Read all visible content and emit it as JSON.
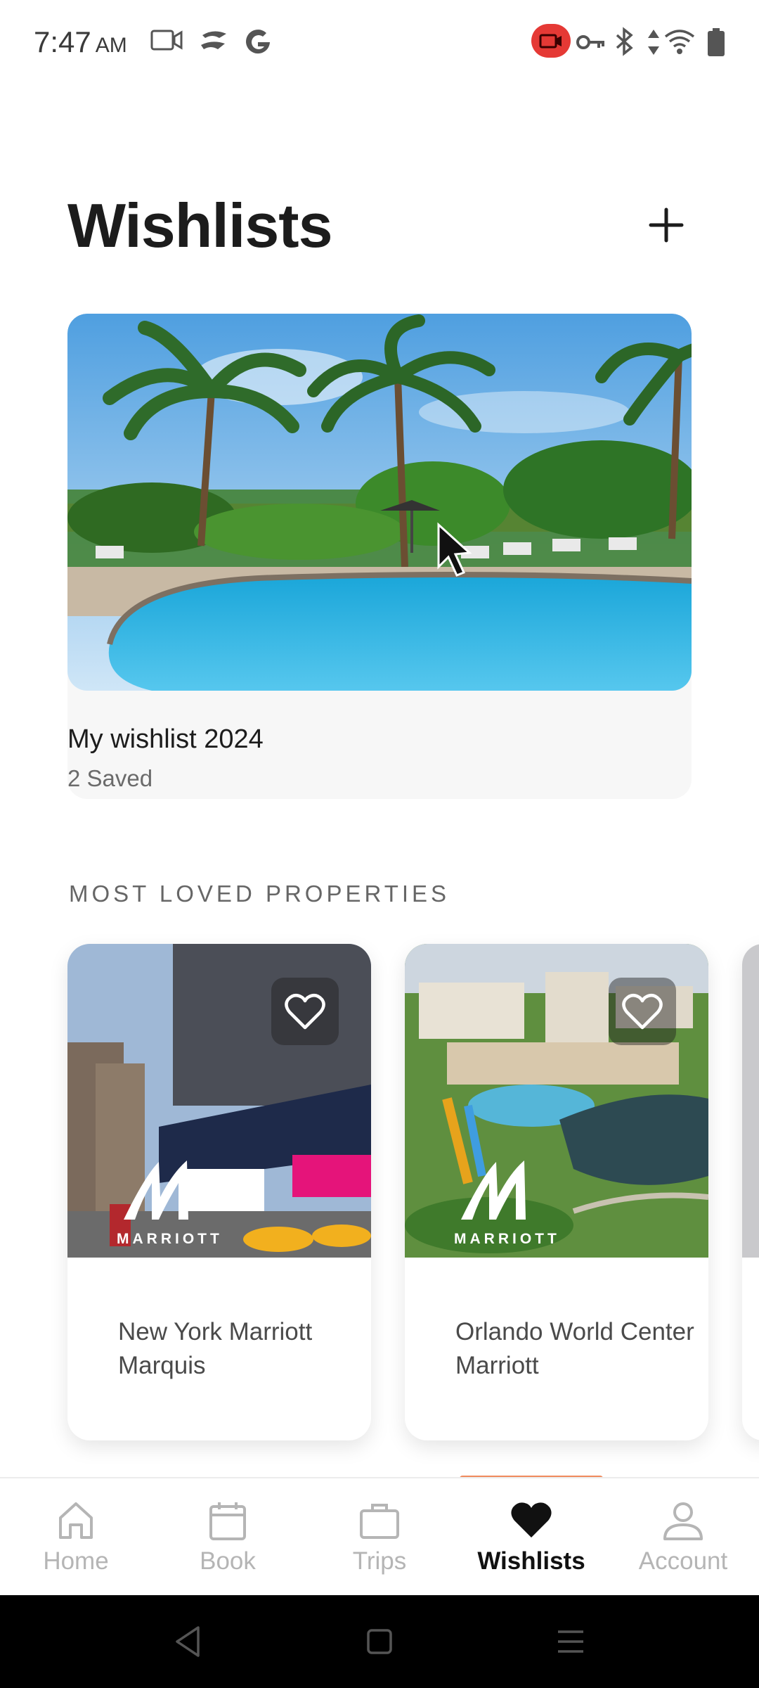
{
  "status_bar": {
    "time": "7:47",
    "ampm": "AM"
  },
  "header": {
    "title": "Wishlists",
    "add_icon": "plus-icon"
  },
  "wishlist": {
    "name": "My wishlist 2024",
    "count": "2 Saved"
  },
  "section": {
    "title": "MOST LOVED PROPERTIES"
  },
  "properties": [
    {
      "name": "New York Marriott Marquis",
      "brand": "MARRIOTT",
      "favorite_icon": "heart-outline-icon"
    },
    {
      "name": "Orlando World Center Marriott",
      "brand": "MARRIOTT",
      "favorite_icon": "heart-outline-icon"
    }
  ],
  "nav": {
    "items": [
      {
        "label": "Home",
        "icon": "home-icon"
      },
      {
        "label": "Book",
        "icon": "calendar-icon"
      },
      {
        "label": "Trips",
        "icon": "briefcase-icon"
      },
      {
        "label": "Wishlists",
        "icon": "heart-icon",
        "active": true
      },
      {
        "label": "Account",
        "icon": "person-icon"
      }
    ]
  },
  "colors": {
    "accent": "#ef8a5c",
    "recording": "#e53935",
    "nav_inactive": "#b5b5b5"
  }
}
